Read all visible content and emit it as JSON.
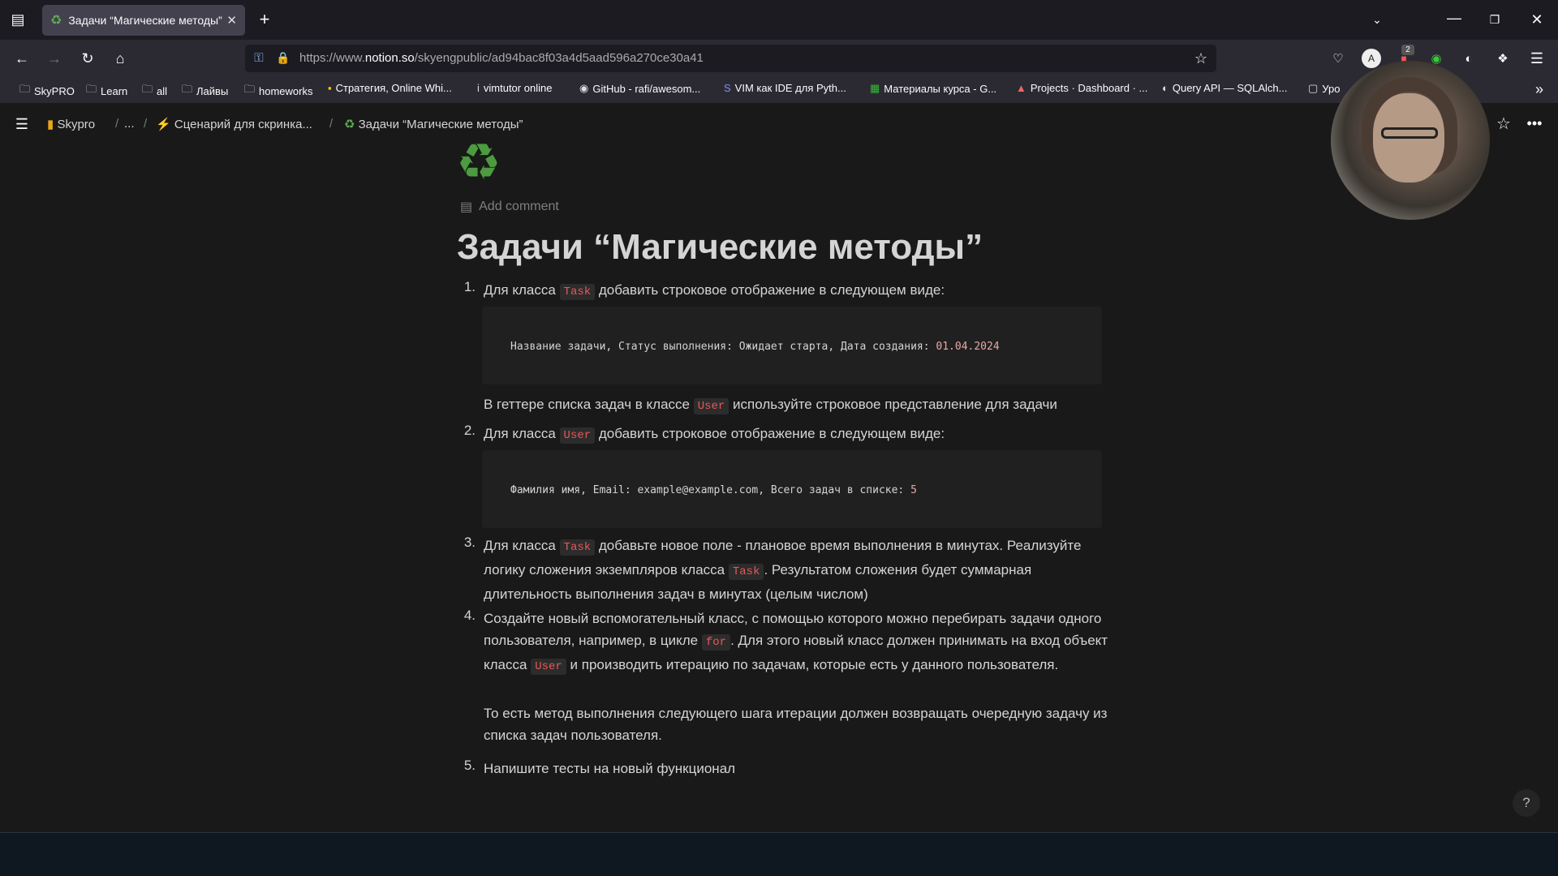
{
  "browser": {
    "tab_title": "Задачи “Магические методы”",
    "url_prefix": "https://www.",
    "url_domain": "notion.so",
    "url_path": "/skyengpublic/ad94bac8f03a4d5aad596a270ce30a41",
    "extension_badge": "2",
    "bookmarks": [
      {
        "label": "SkyPRO",
        "icon": "folder-icon"
      },
      {
        "label": "Learn",
        "icon": "folder-icon"
      },
      {
        "label": "all",
        "icon": "folder-icon"
      },
      {
        "label": "Лайвы",
        "icon": "folder-icon"
      },
      {
        "label": "homeworks",
        "icon": "folder-icon"
      },
      {
        "label": "Стратегия, Online Whi...",
        "icon": "miro-icon"
      },
      {
        "label": "vimtutor online",
        "icon": "info-icon"
      },
      {
        "label": "GitHub - rafi/awesom...",
        "icon": "github-icon"
      },
      {
        "label": "VIM как IDE для Pyth...",
        "icon": "s-icon"
      },
      {
        "label": "Материалы курса - G...",
        "icon": "sheets-icon"
      },
      {
        "label": "Projects · Dashboard · ...",
        "icon": "gitlab-icon"
      },
      {
        "label": "Query API — SQLAlch...",
        "icon": "globe-icon"
      },
      {
        "label": "Уро",
        "icon": "doc-icon"
      }
    ]
  },
  "notion": {
    "breadcrumbs": [
      "Skypro",
      "...",
      "Сценарий для скринка...",
      "Задачи “Магические методы”"
    ],
    "add_comment": "Add comment",
    "title": "Задачи “Магические методы”",
    "items": [
      {
        "num": "1.",
        "pre": "Для класса ",
        "code": "Task",
        "post": " добавить строковое отображение в следующем виде:",
        "codeblock_text": "Название задачи, Статус выполнения: Ожидает старта, Дата создания: ",
        "codeblock_num": "01.04.2024",
        "after_pre": "В геттере списка задач в классе ",
        "after_code": "User",
        "after_post": " используйте строковое представление для задачи"
      },
      {
        "num": "2.",
        "pre": "Для класса ",
        "code": "User",
        "post": " добавить строковое отображение в следующем виде:",
        "codeblock_text": "Фамилия имя, Email: example@example.com, Всего задач в списке: ",
        "codeblock_num": "5"
      },
      {
        "num": "3.",
        "pre": "Для класса ",
        "code": "Task",
        "mid": " добавьте новое поле - плановое время выполнения в минутах. Реализуйте логику сложения экземпляров класса ",
        "code2": "Task",
        "post": ".  Результатом сложения будет суммарная длительность выполнения задач в минутах (целым числом)"
      },
      {
        "num": "4.",
        "pre": "Создайте новый вспомогательный класс, с помощью которого можно перебирать задачи одного пользователя, например, в цикле ",
        "code": "for",
        "mid": ". Для этого новый класс должен принимать на вход объект класса ",
        "code2": "User",
        "post": " и производить итерацию по задачам, которые есть у данного пользователя.",
        "after": "То есть метод выполнения следующего шага итерации должен возвращать очередную задачу из списка задач пользователя."
      },
      {
        "num": "5.",
        "text": "Напишите тесты на новый функционал"
      }
    ],
    "help": "?"
  }
}
